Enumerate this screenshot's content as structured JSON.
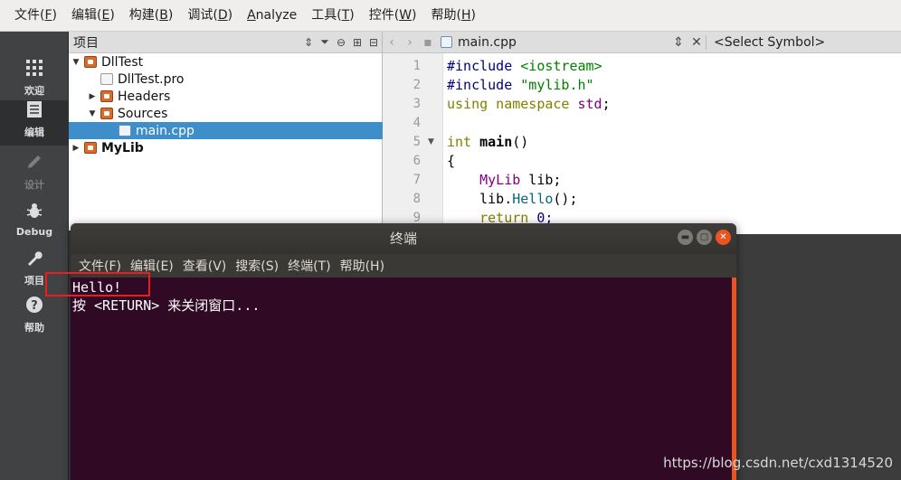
{
  "menubar": {
    "items": [
      {
        "label": "文件(",
        "key": "F",
        "tail": ")"
      },
      {
        "label": "编辑(",
        "key": "E",
        "tail": ")"
      },
      {
        "label": "构建(",
        "key": "B",
        "tail": ")"
      },
      {
        "label": "调试(",
        "key": "D",
        "tail": ")"
      },
      {
        "label": "",
        "key": "A",
        "tail": "nalyze"
      },
      {
        "label": "工具(",
        "key": "T",
        "tail": ")"
      },
      {
        "label": "控件(",
        "key": "W",
        "tail": ")"
      },
      {
        "label": "帮助(",
        "key": "H",
        "tail": ")"
      }
    ]
  },
  "modes": [
    {
      "label": "欢迎",
      "icon": "grid-icon"
    },
    {
      "label": "编辑",
      "icon": "document-icon"
    },
    {
      "label": "设计",
      "icon": "pencil-icon"
    },
    {
      "label": "Debug",
      "icon": "bug-icon"
    },
    {
      "label": "项目",
      "icon": "wrench-icon"
    },
    {
      "label": "帮助",
      "icon": "question-icon"
    }
  ],
  "project_panel": {
    "title": "项目",
    "tree": [
      {
        "label": "DllTest",
        "expanded": true
      },
      {
        "label": "DllTest.pro"
      },
      {
        "label": "Headers",
        "expanded": false
      },
      {
        "label": "Sources",
        "expanded": true
      },
      {
        "label": "main.cpp",
        "selected": true
      },
      {
        "label": "MyLib",
        "expanded": false
      }
    ]
  },
  "editor": {
    "filename": "main.cpp",
    "symbol": "<Select Symbol>",
    "line_numbers": [
      "1",
      "2",
      "3",
      "4",
      "5",
      "6",
      "7",
      "8",
      "9"
    ],
    "lines": [
      {
        "a": "#include ",
        "b": "<iostream>"
      },
      {
        "a": "#include ",
        "b": "\"mylib.h\""
      },
      {
        "a": "using namespace ",
        "b": "std",
        "c": ";"
      },
      {
        "a": ""
      },
      {
        "a": "int ",
        "b": "main",
        "c": "()"
      },
      {
        "a": "{"
      },
      {
        "a": "    ",
        "b": "MyLib",
        "c": " lib;"
      },
      {
        "a": "    lib.",
        "b": "Hello",
        "c": "();"
      },
      {
        "a": "    ",
        "b": "return",
        "c": " 0;"
      }
    ]
  },
  "terminal": {
    "title": "终端",
    "menu": [
      "文件(F)",
      "编辑(E)",
      "查看(V)",
      "搜索(S)",
      "终端(T)",
      "帮助(H)"
    ],
    "output": [
      "Hello!",
      "按 <RETURN> 来关闭窗口..."
    ]
  },
  "watermark": "https://blog.csdn.net/cxd1314520",
  "colors": {
    "terminal_bg": "#300a24",
    "selection": "#3d8ec9",
    "highlight_box": "#ee1c1c",
    "close_button": "#e95420"
  }
}
